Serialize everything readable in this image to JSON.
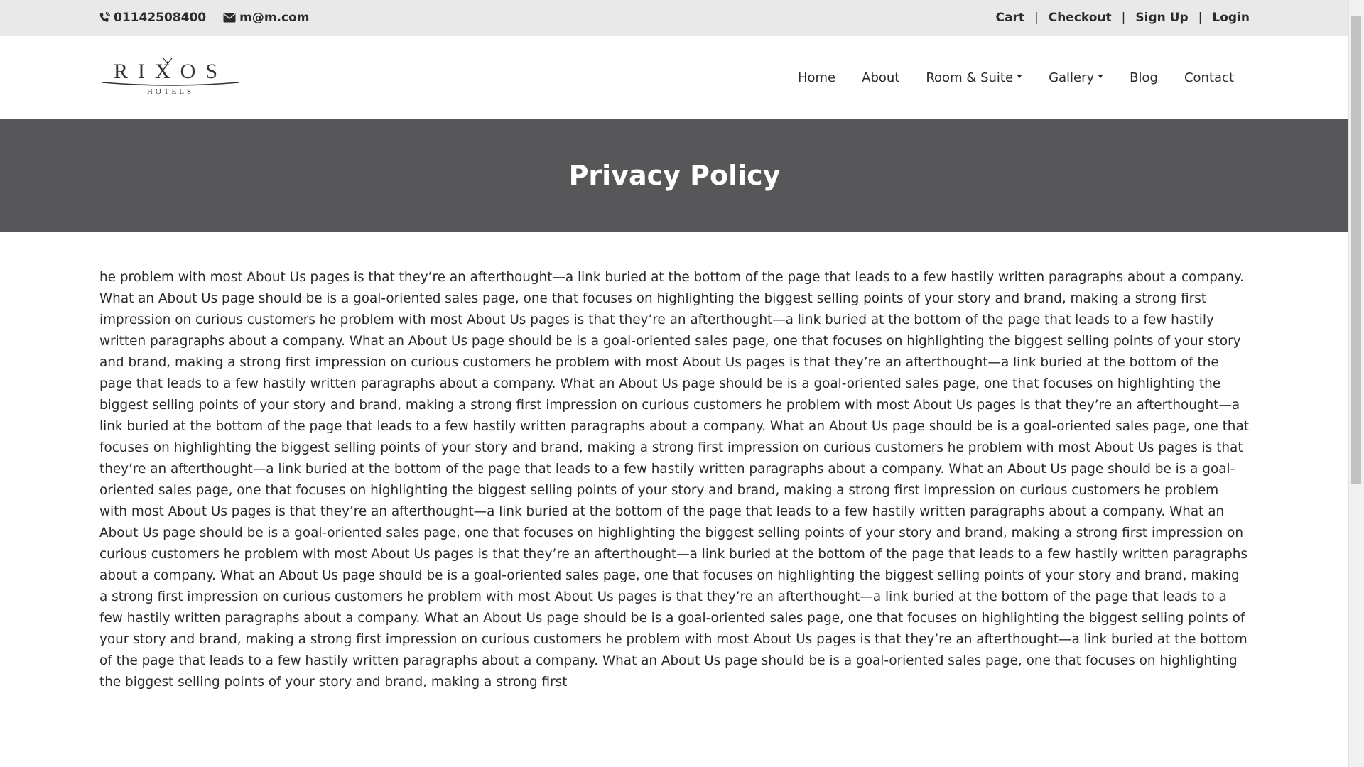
{
  "topbar": {
    "phone": "01142508400",
    "email": "m@m.com",
    "links": [
      "Cart",
      "Checkout",
      "Sign Up",
      "Login"
    ]
  },
  "logo": {
    "name": "RIXOS",
    "tagline": "HOTELS"
  },
  "nav": {
    "home": "Home",
    "about": "About",
    "rooms": "Room & Suite",
    "gallery": "Gallery",
    "blog": "Blog",
    "contact": "Contact"
  },
  "banner": {
    "title": "Privacy Policy"
  },
  "content": {
    "paragraph": "he problem with most About Us pages is that they’re an afterthought—a link buried at the bottom of the page that leads to a few hastily written paragraphs about a company. What an About Us page should be is a goal-oriented sales page, one that focuses on highlighting the biggest selling points of your story and brand, making a strong first impression on curious customers he problem with most About Us pages is that they’re an afterthought—a link buried at the bottom of the page that leads to a few hastily written paragraphs about a company. What an About Us page should be is a goal-oriented sales page, one that focuses on highlighting the biggest selling points of your story and brand, making a strong first impression on curious customers he problem with most About Us pages is that they’re an afterthought—a link buried at the bottom of the page that leads to a few hastily written paragraphs about a company. What an About Us page should be is a goal-oriented sales page, one that focuses on highlighting the biggest selling points of your story and brand, making a strong first impression on curious customers he problem with most About Us pages is that they’re an afterthought—a link buried at the bottom of the page that leads to a few hastily written paragraphs about a company. What an About Us page should be is a goal-oriented sales page, one that focuses on highlighting the biggest selling points of your story and brand, making a strong first impression on curious customers he problem with most About Us pages is that they’re an afterthought—a link buried at the bottom of the page that leads to a few hastily written paragraphs about a company. What an About Us page should be is a goal-oriented sales page, one that focuses on highlighting the biggest selling points of your story and brand, making a strong first impression on curious customers he problem with most About Us pages is that they’re an afterthought—a link buried at the bottom of the page that leads to a few hastily written paragraphs about a company. What an About Us page should be is a goal-oriented sales page, one that focuses on highlighting the biggest selling points of your story and brand, making a strong first impression on curious customers he problem with most About Us pages is that they’re an afterthought—a link buried at the bottom of the page that leads to a few hastily written paragraphs about a company. What an About Us page should be is a goal-oriented sales page, one that focuses on highlighting the biggest selling points of your story and brand, making a strong first impression on curious customers he problem with most About Us pages is that they’re an afterthought—a link buried at the bottom of the page that leads to a few hastily written paragraphs about a company. What an About Us page should be is a goal-oriented sales page, one that focuses on highlighting the biggest selling points of your story and brand, making a strong first impression on curious customers he problem with most About Us pages is that they’re an afterthought—a link buried at the bottom of the page that leads to a few hastily written paragraphs about a company. What an About Us page should be is a goal-oriented sales page, one that focuses on highlighting the biggest selling points of your story and brand, making a strong first"
  },
  "icons": {
    "phone": "phone-icon",
    "email": "envelope-icon"
  }
}
